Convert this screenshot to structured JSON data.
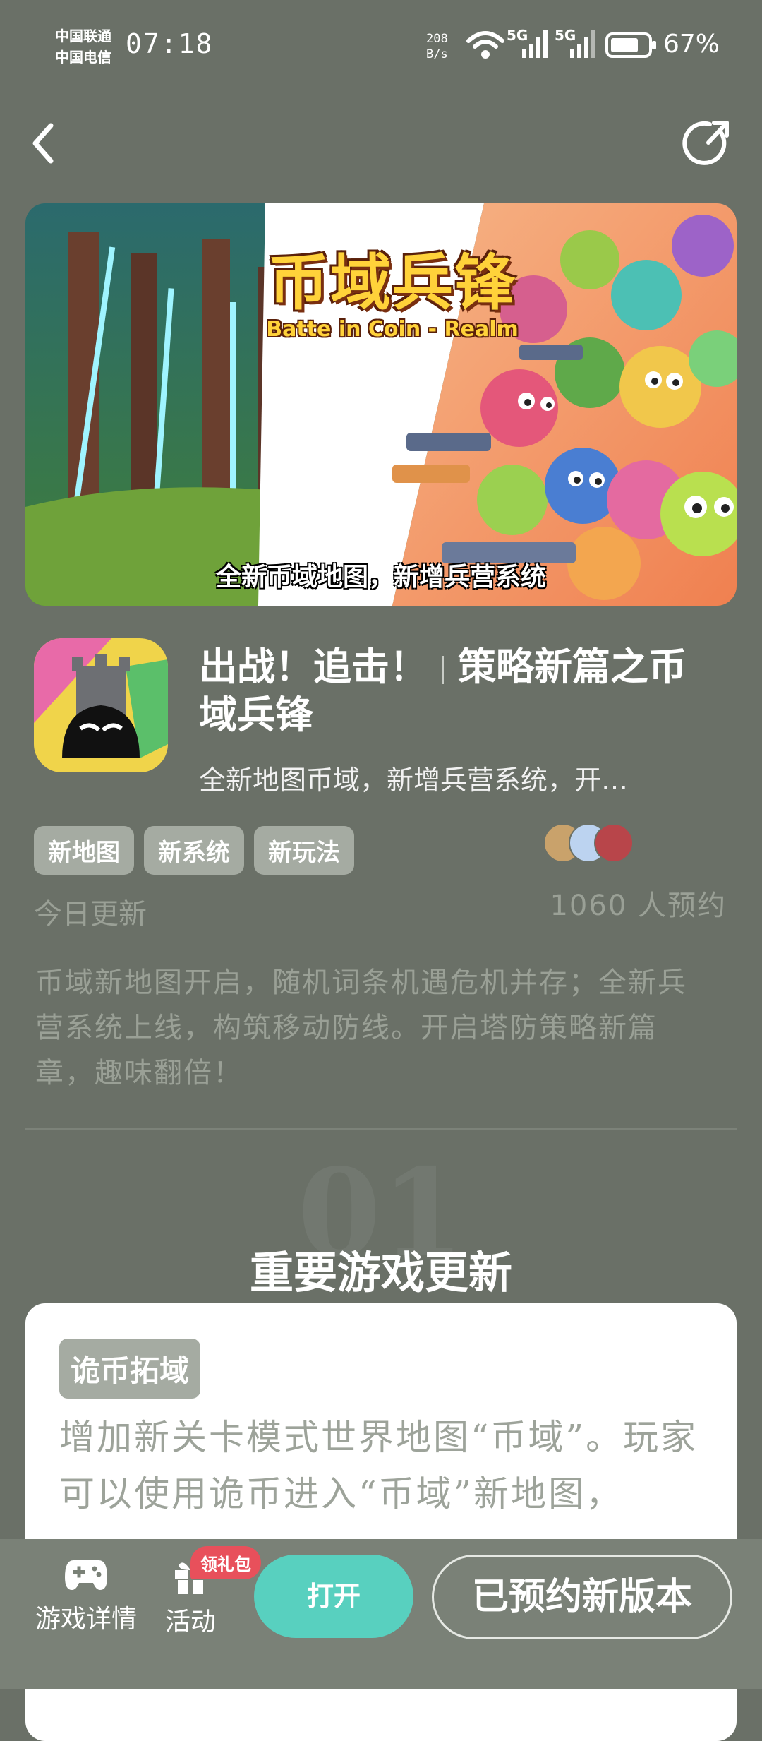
{
  "status_bar": {
    "carrier_1": "中国联通",
    "carrier_2": "中国电信",
    "time": "07:18",
    "net_speed_value": "208",
    "net_speed_unit": "B/s",
    "network_1": "5G",
    "network_2": "5G",
    "battery": "67%"
  },
  "banner": {
    "game_logo_title": "币域兵锋",
    "game_logo_subtitle": "Batte in Coin - Realm",
    "caption": "全新币域地图，新增兵营系统"
  },
  "app": {
    "title_part_1": "出战！追击！",
    "title_part_2": "策略新篇之币域兵锋",
    "description": "全新地图币域，新增兵营系统，开…",
    "tags": [
      "新地图",
      "新系统",
      "新玩法"
    ],
    "update_label": "今日更新",
    "reserve_count": "1060 人预约",
    "summary": "币域新地图开启，随机词条机遇危机并存；全新兵营系统上线，构筑移动防线。开启塔防策略新篇章，趣味翻倍！"
  },
  "section": {
    "number": "01",
    "title": "重要游戏更新",
    "card_tag": "诡币拓域",
    "card_text": "增加新关卡模式世界地图“币域”。玩家可以使用诡币进入“币域”新地图，"
  },
  "bottom_bar": {
    "game_details": "游戏详情",
    "activity": "活动",
    "gift_badge": "领礼包",
    "open_button": "打开",
    "reserved_button": "已预约新版本"
  },
  "colors": {
    "page_bg": "#6a7067",
    "accent_teal": "#58d0bf",
    "badge_red": "#e8505b",
    "tag_bg": "#a5aba2"
  }
}
